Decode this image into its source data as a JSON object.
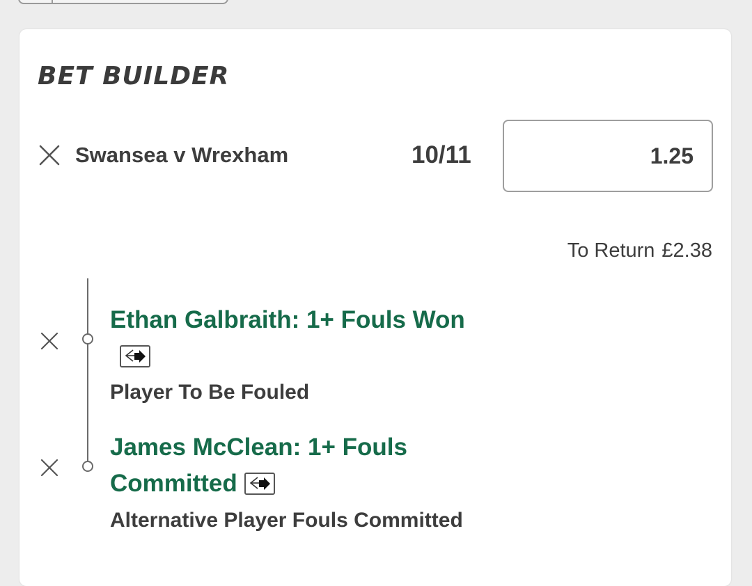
{
  "bet_builder": {
    "title": "BET BUILDER",
    "event": {
      "name": "Swansea v Wrexham",
      "odds": "10/11",
      "stake": "1.25"
    },
    "return": {
      "label": "To Return",
      "value": "£2.38"
    },
    "selections": [
      {
        "name": "Ethan Galbraith: 1+ Fouls Won",
        "market": "Player To Be Fouled",
        "icon": "swap-icon"
      },
      {
        "name_line1": "James McClean: 1+ Fouls",
        "name_line2": "Committed",
        "market": "Alternative Player Fouls Committed",
        "icon": "swap-icon"
      }
    ],
    "colors": {
      "selection_green": "#166b4a",
      "text_dark": "#3d3d3d",
      "background": "#ededed"
    }
  }
}
